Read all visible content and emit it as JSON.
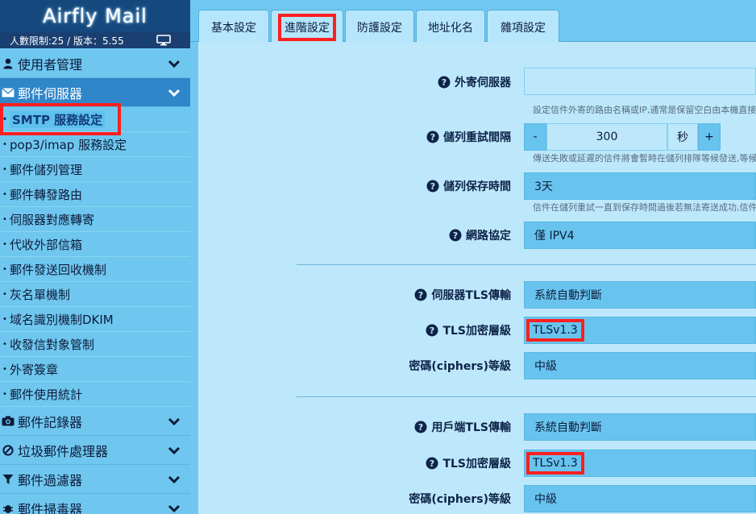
{
  "app": {
    "logo": "Airfly Mail",
    "status": "人數限制:25 / 版本：5.55"
  },
  "sidebar": {
    "groups": [
      {
        "label": "使用者管理",
        "icon": "user-icon"
      },
      {
        "label": "郵件伺服器",
        "icon": "envelope-icon"
      },
      {
        "label": "郵件記錄器",
        "icon": "camera-icon"
      },
      {
        "label": "垃圾郵件處理器",
        "icon": "ban-icon"
      },
      {
        "label": "郵件過濾器",
        "icon": "filter-icon"
      },
      {
        "label": "郵件掃毒器",
        "icon": "bug-icon"
      }
    ],
    "items": [
      "SMTP 服務設定",
      "pop3/imap 服務設定",
      "郵件儲列管理",
      "郵件轉發路由",
      "伺服器對應轉寄",
      "代收外部信箱",
      "郵件發送回收機制",
      "灰名單機制",
      "域名識別機制DKIM",
      "收發信對象管制",
      "外寄簽章",
      "郵件使用統計"
    ]
  },
  "tabs": [
    "基本設定",
    "進階設定",
    "防護設定",
    "地址化名",
    "雜項設定"
  ],
  "active_tab": "進階設定",
  "form": {
    "outbound_server": {
      "label": "外寄伺服器",
      "value": "",
      "hint": "設定信件外寄的路由名稱或IP,通常是保留空白由本機直接"
    },
    "retry_interval": {
      "label": "儲列重試間隔",
      "minus": "-",
      "value": "300",
      "unit": "秒",
      "plus": "+",
      "hint": "傳送失敗或延遲的信件將會暫時在儲列排隊等候發送,等候"
    },
    "queue_retention": {
      "label": "儲列保存時間",
      "value": "3天",
      "hint": "信件在儲列重試一直到保存時間過後若無法寄送成功,信件"
    },
    "network_protocol": {
      "label": "網路協定",
      "value": "僅 IPV4"
    },
    "server_tls": {
      "label": "伺服器TLS傳輸",
      "value": "系統自動判斷"
    },
    "server_tls_level": {
      "label": "TLS加密層級",
      "value": "TLSv1.3"
    },
    "server_ciphers": {
      "label": "密碼(ciphers)等級",
      "value": "中級"
    },
    "client_tls": {
      "label": "用戶端TLS傳輸",
      "value": "系統自動判斷"
    },
    "client_tls_level": {
      "label": "TLS加密層級",
      "value": "TLSv1.3"
    },
    "client_ciphers": {
      "label": "密碼(ciphers)等級",
      "value": "中級"
    }
  }
}
